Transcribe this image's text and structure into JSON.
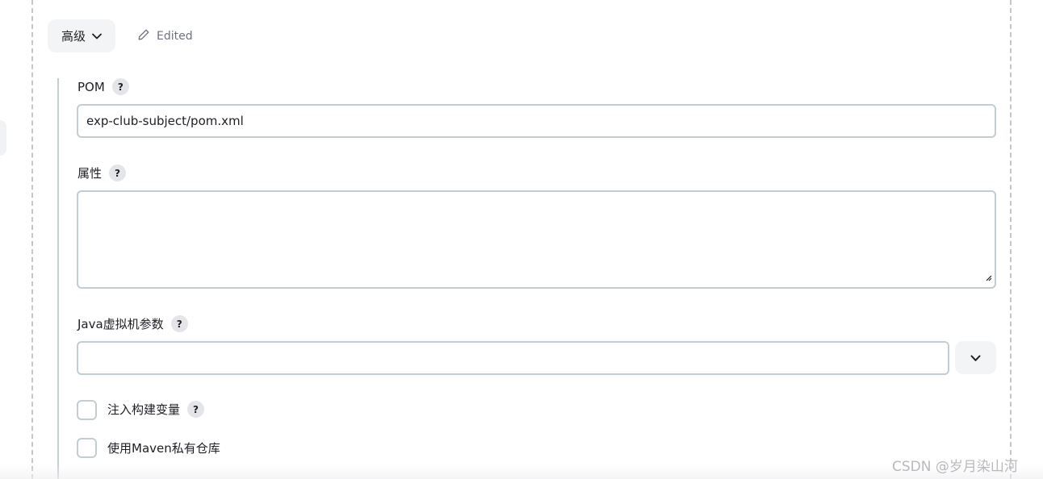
{
  "advanced_toggle": {
    "label": "高级",
    "icon": "chevron-down-icon"
  },
  "edited_indicator": {
    "label": "Edited",
    "icon": "pencil-icon"
  },
  "pom": {
    "label": "POM",
    "help": "?",
    "value": "exp-club-subject/pom.xml"
  },
  "properties": {
    "label": "属性",
    "help": "?",
    "value": ""
  },
  "jvm_options": {
    "label": "Java虚拟机参数",
    "help": "?",
    "value": "",
    "dropdown_icon": "chevron-down-icon"
  },
  "inject_build_vars": {
    "label": "注入构建变量",
    "help": "?",
    "checked": false
  },
  "private_maven_repo": {
    "label": "使用Maven私有仓库",
    "checked": false
  },
  "watermark": "CSDN @岁月染山河",
  "colors": {
    "border": "#c3ccd0",
    "button_bg": "#f3f4f6",
    "help_bg": "#e4e5e8",
    "text": "#1e1e24",
    "muted": "#6e7280"
  }
}
